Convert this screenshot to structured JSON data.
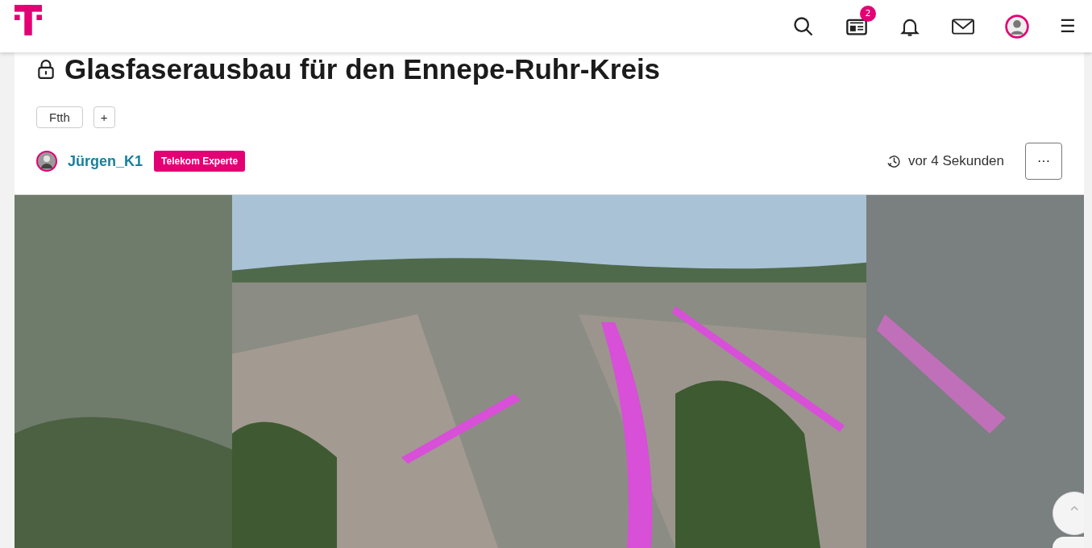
{
  "header": {
    "notification_badge": "2",
    "menu_glyph": "☰"
  },
  "post": {
    "title": "Glasfaserausbau für den Ennepe-Ruhr-Kreis",
    "locked": true,
    "tags": [
      "Ftth"
    ],
    "add_tag": "+",
    "author": {
      "name": "Jürgen_K1",
      "badge": "Telekom Experte"
    },
    "time": "vor 4 Sekunden",
    "more": "···"
  },
  "scroll_top": "⌃"
}
